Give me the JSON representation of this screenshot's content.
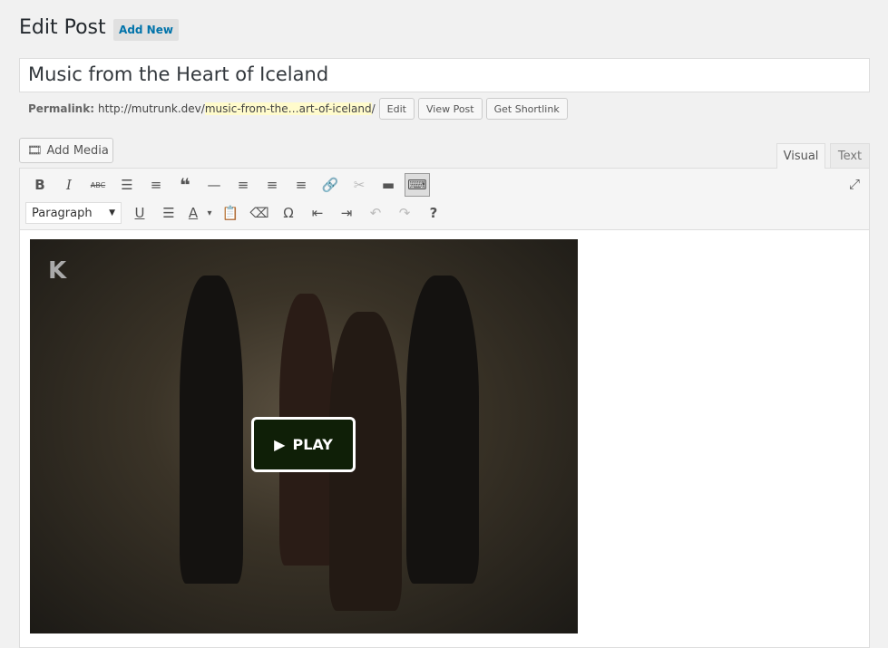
{
  "header": {
    "title": "Edit Post",
    "add_new": "Add New"
  },
  "post": {
    "title": "Music from the Heart of Iceland"
  },
  "permalink": {
    "label": "Permalink:",
    "base": "http://mutrunk.dev/",
    "slug": "music-from-the…art-of-iceland",
    "trail": "/",
    "edit": "Edit",
    "view": "View Post",
    "shortlink": "Get Shortlink"
  },
  "editor": {
    "add_media": "Add Media",
    "tab_visual": "Visual",
    "tab_text": "Text",
    "format": "Paragraph",
    "row1": [
      "B",
      "I",
      "ABC",
      "☰",
      "≡",
      "❝",
      "—",
      "≡",
      "≡",
      "≡",
      "🔗",
      "✂",
      "▬",
      "⌨"
    ],
    "row2": [
      "U",
      "☰",
      "A",
      "▾",
      "📋",
      "⌫",
      "Ω",
      "⇤",
      "⇥",
      "↶",
      "↷",
      "?"
    ],
    "embed": {
      "logo": "K",
      "play": "PLAY"
    }
  }
}
